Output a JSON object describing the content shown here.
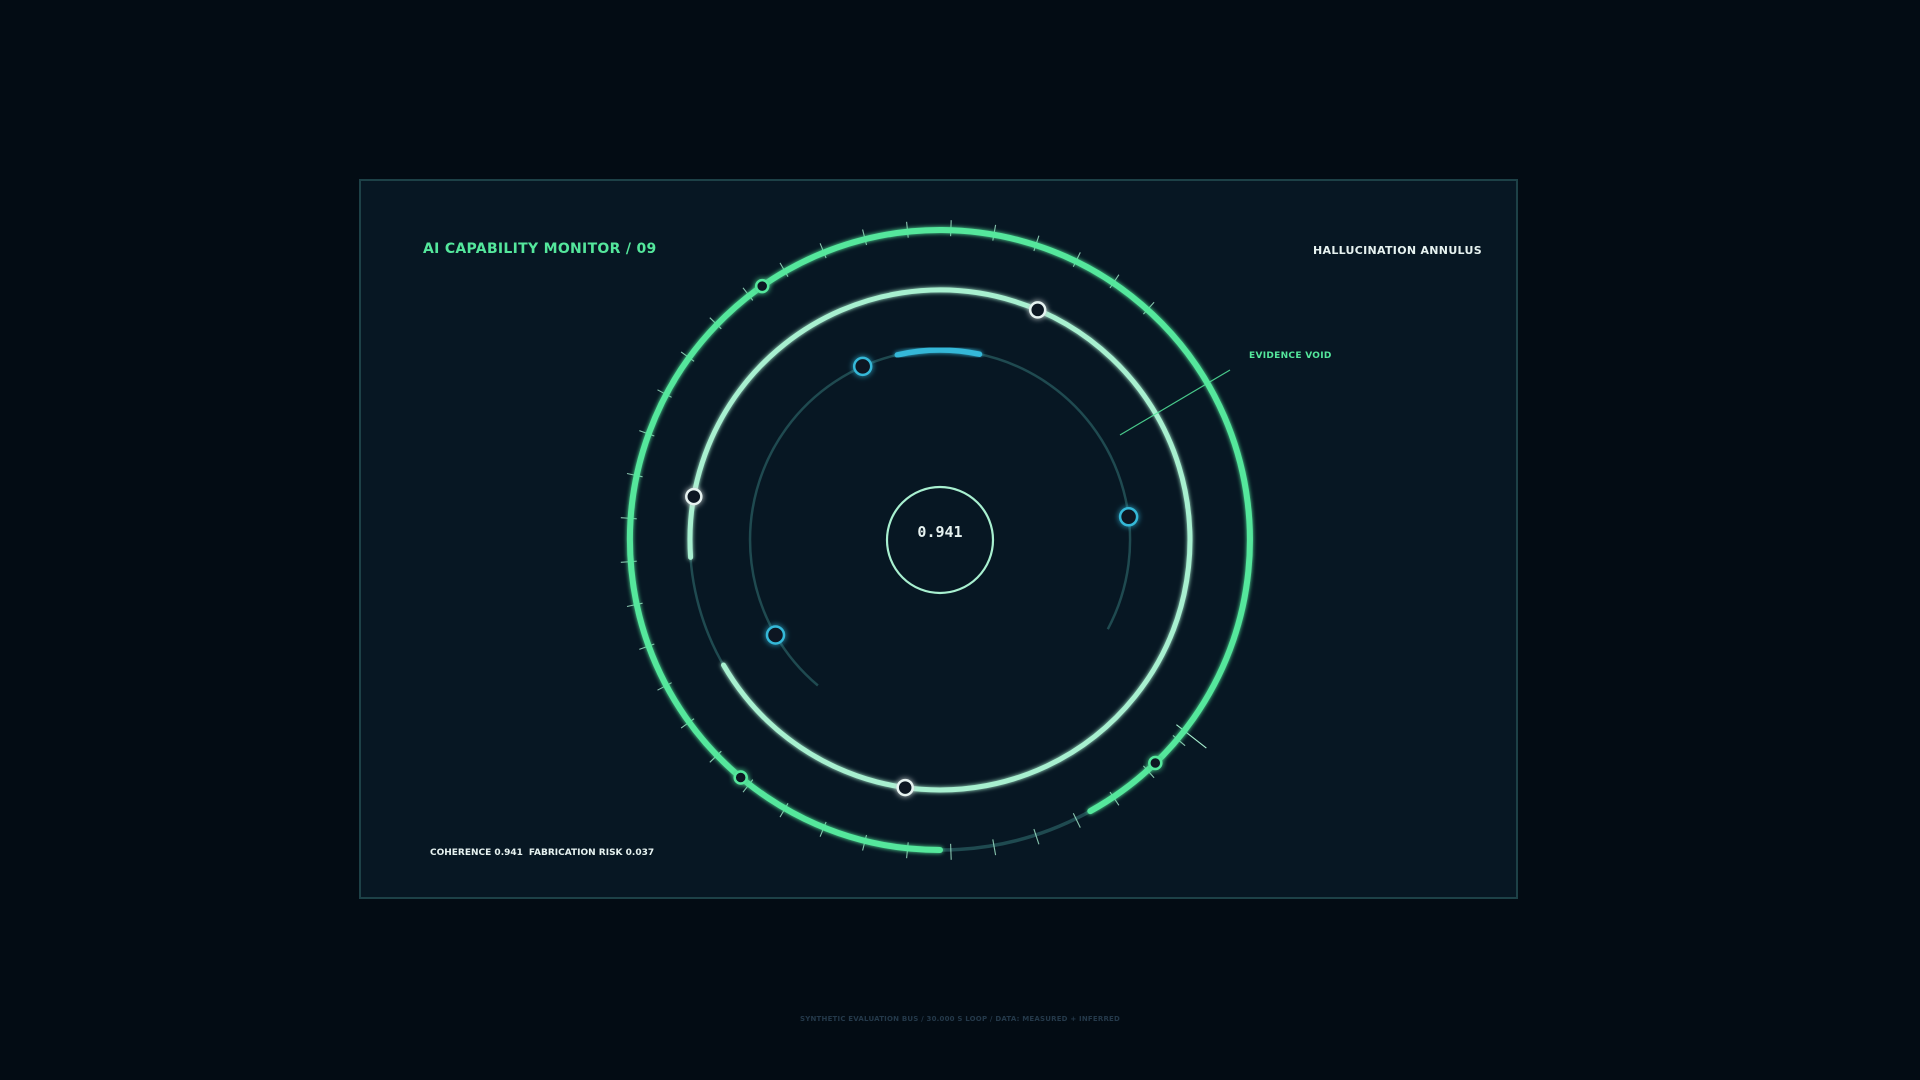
{
  "panel": {
    "title": "AI CAPABILITY MONITOR / 09",
    "subtitle": "HALLUCINATION ANNULUS",
    "callout": "EVIDENCE VOID",
    "center_value": "0.941",
    "readouts": {
      "coherence": "COHERENCE 0.941",
      "fabrication": "FABRICATION RISK 0.037"
    }
  },
  "footer": "SYNTHETIC EVALUATION BUS  /  30.000 S LOOP  /  DATA: MEASURED + INFERRED",
  "colors": {
    "background": "#030c14",
    "panel": "#071723",
    "panel_border": "#1d4147",
    "ring": "#1f4a50",
    "green": "#54e79c",
    "mint": "#a8f0d0",
    "cyan": "#34b8d8",
    "white": "#e6f2f0"
  }
}
